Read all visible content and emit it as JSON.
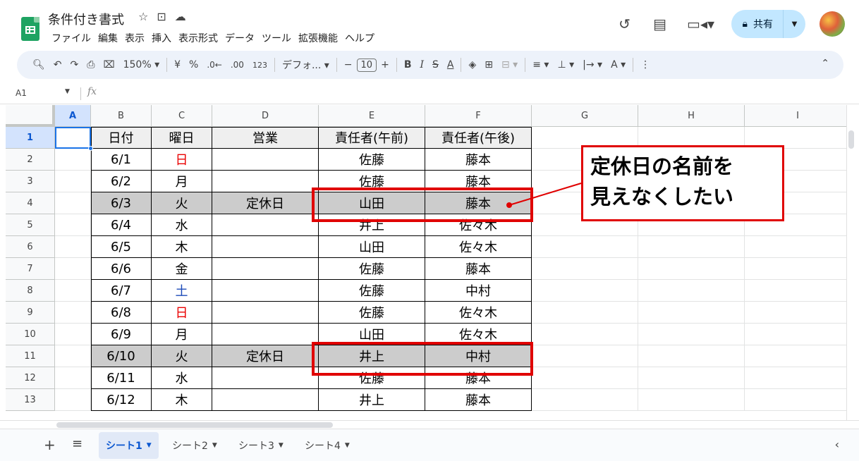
{
  "title_bar": {
    "doc_title": "条件付き書式",
    "title_icons": [
      "star-icon",
      "move-to-folder-icon",
      "cloud-status-icon"
    ],
    "menu": [
      "ファイル",
      "編集",
      "表示",
      "挿入",
      "表示形式",
      "データ",
      "ツール",
      "拡張機能",
      "ヘルプ"
    ],
    "share_label": "共有"
  },
  "toolbar": {
    "zoom": "150%",
    "currency": "¥",
    "percent": "%",
    "dec_decrease": ".0←",
    "dec_increase": ".00",
    "format_123": "123",
    "font": "デフォ...",
    "font_size": "10",
    "bold": "B",
    "italic": "I",
    "strike": "S",
    "text_color": "A"
  },
  "formula_bar": {
    "name_box": "A1",
    "fx": "fx"
  },
  "columns": [
    "A",
    "B",
    "C",
    "D",
    "E",
    "F",
    "G",
    "H",
    "I"
  ],
  "rows": [
    {
      "num": "1",
      "date": "日付",
      "day": "曜日",
      "biz": "営業",
      "am": "責任者(午前)",
      "pm": "責任者(午後)",
      "header": true
    },
    {
      "num": "2",
      "date": "6/1",
      "day": "日",
      "biz": "",
      "am": "佐藤",
      "pm": "藤本",
      "day_color": "#ea0000"
    },
    {
      "num": "3",
      "date": "6/2",
      "day": "月",
      "biz": "",
      "am": "佐藤",
      "pm": "藤本"
    },
    {
      "num": "4",
      "date": "6/3",
      "day": "火",
      "biz": "定休日",
      "am": "山田",
      "pm": "藤本",
      "closed": true
    },
    {
      "num": "5",
      "date": "6/4",
      "day": "水",
      "biz": "",
      "am": "井上",
      "pm": "佐々木"
    },
    {
      "num": "6",
      "date": "6/5",
      "day": "木",
      "biz": "",
      "am": "山田",
      "pm": "佐々木"
    },
    {
      "num": "7",
      "date": "6/6",
      "day": "金",
      "biz": "",
      "am": "佐藤",
      "pm": "藤本"
    },
    {
      "num": "8",
      "date": "6/7",
      "day": "土",
      "biz": "",
      "am": "佐藤",
      "pm": "中村",
      "day_color": "#1c4ab8"
    },
    {
      "num": "9",
      "date": "6/8",
      "day": "日",
      "biz": "",
      "am": "佐藤",
      "pm": "佐々木",
      "day_color": "#ea0000"
    },
    {
      "num": "10",
      "date": "6/9",
      "day": "月",
      "biz": "",
      "am": "山田",
      "pm": "佐々木"
    },
    {
      "num": "11",
      "date": "6/10",
      "day": "火",
      "biz": "定休日",
      "am": "井上",
      "pm": "中村",
      "closed": true
    },
    {
      "num": "12",
      "date": "6/11",
      "day": "水",
      "biz": "",
      "am": "佐藤",
      "pm": "藤本"
    },
    {
      "num": "13",
      "date": "6/12",
      "day": "木",
      "biz": "",
      "am": "井上",
      "pm": "藤本"
    }
  ],
  "callout": {
    "line1": "定休日の名前を",
    "line2": "見えなくしたい"
  },
  "sheet_tabs": [
    "シート1",
    "シート2",
    "シート3",
    "シート4"
  ],
  "colors": {
    "highlight_red": "#e00000",
    "closed_gray": "#cccccc",
    "selection_blue": "#1a73e8",
    "share_bg": "#c2e7ff"
  }
}
